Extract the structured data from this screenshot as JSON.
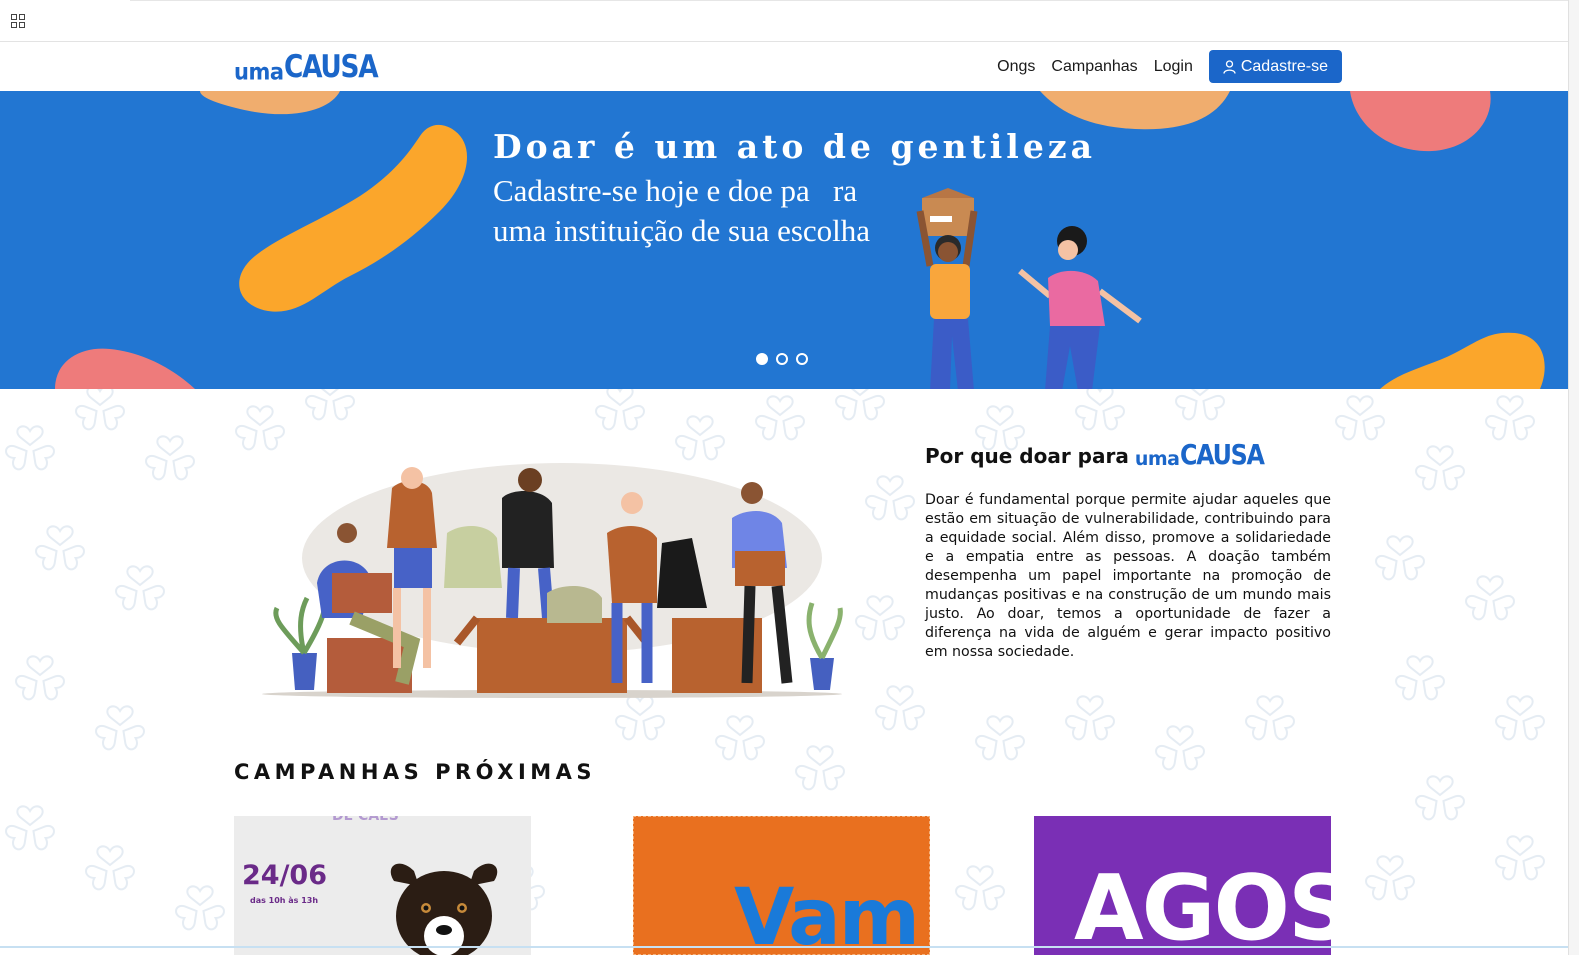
{
  "brand": {
    "logo_small": "uma",
    "logo_big": "CAUSA",
    "color": "#1b66c9"
  },
  "nav": {
    "links": [
      "Ongs",
      "Campanhas",
      "Login"
    ],
    "cta_label": "Cadastre-se"
  },
  "hero": {
    "title": "Doar é um ato de gentileza",
    "subtitle_line1": "Cadastre-se hoje e doe pa   ra",
    "subtitle_line2": "uma instituição de sua escolha",
    "background": "#2276d2",
    "slides_total": 3,
    "active_slide": 1
  },
  "why": {
    "title": "Por que doar para",
    "text": "Doar é fundamental porque permite ajudar aqueles que estão em situação de vulnerabilidade, contribuindo para a equidade social. Além disso, promove a solidariedade e a empatia entre as pessoas. A doação também desempenha um papel importante na promoção de mudanças positivas e na construção de um mundo mais justo. Ao doar, temos a oportunidade de fazer a diferença na vida de alguém e gerar impacto positivo em nossa sociedade."
  },
  "campaigns": {
    "title": "CAMPANHAS PRÓXIMAS",
    "cards": [
      {
        "date": "24/06",
        "hours": "das 10h às 13h",
        "top": "DE CÃES",
        "color": "#ececec"
      },
      {
        "big": "Vam",
        "color": "#e9701f"
      },
      {
        "big": "AGOS",
        "color": "#7a2fb5"
      }
    ]
  }
}
